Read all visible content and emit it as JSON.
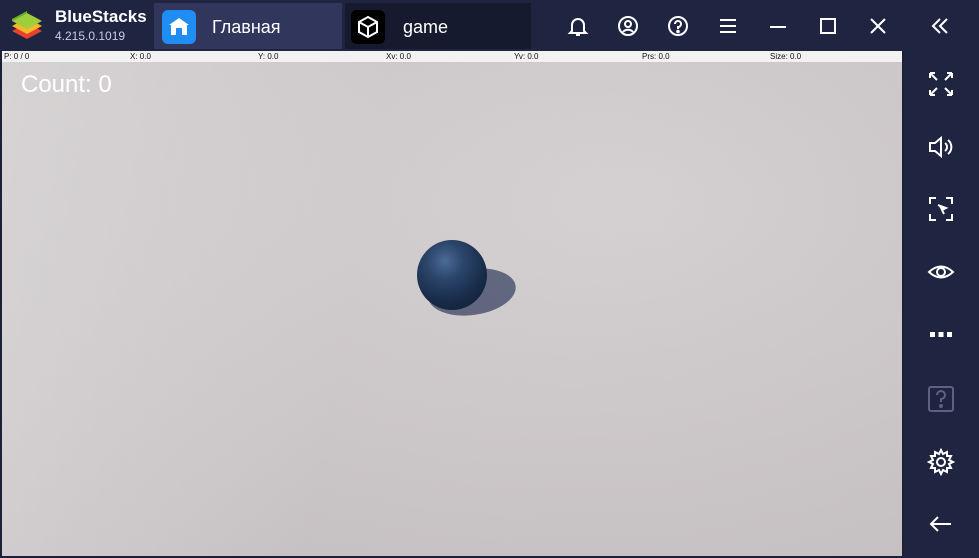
{
  "app": {
    "name": "BlueStacks",
    "version": "4.215.0.1019"
  },
  "tabs": [
    {
      "label": "Главная",
      "icon": "home-icon"
    },
    {
      "label": "game",
      "icon": "unity-icon"
    }
  ],
  "titlebar_icons": [
    "bell-icon",
    "account-icon",
    "help-icon",
    "menu-icon",
    "minimize-icon",
    "maximize-icon",
    "close-icon",
    "collapse-sidebar-icon"
  ],
  "game": {
    "debug": {
      "p": "P: 0 / 0",
      "x": "X: 0.0",
      "y": "Y: 0.0",
      "xv": "Xv: 0.0",
      "yv": "Yv: 0.0",
      "prs": "Prs: 0.0",
      "size": "Size: 0.0"
    },
    "count_label": "Count: 0"
  },
  "sidebar_icons": [
    "fullscreen-icon",
    "volume-icon",
    "screenshot-icon",
    "eye-icon",
    "more-icon",
    "help-icon",
    "settings-icon",
    "back-icon"
  ],
  "colors": {
    "titlebar": "#1f2441",
    "tab_active": "#31375c",
    "home_icon_bg": "#1f8df2",
    "ball": "#1f3454"
  }
}
